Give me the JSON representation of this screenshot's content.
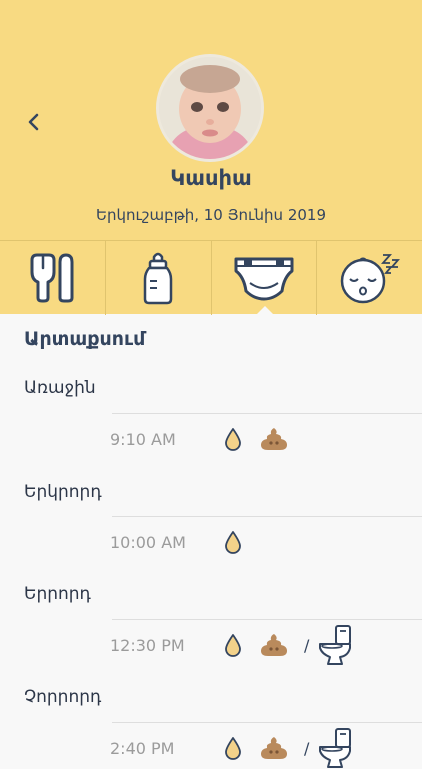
{
  "header": {
    "name": "Կասիա",
    "date": "Երկուշաբթի, 10 Յունիս 2019"
  },
  "colors": {
    "header_bg": "#f8da82",
    "accent_text": "#34455f",
    "pee_drop": "#f3d28a",
    "poop": "#b98a5c"
  },
  "tabs": [
    {
      "icon": "feeding-icon"
    },
    {
      "icon": "bottle-icon"
    },
    {
      "icon": "diaper-icon",
      "selected": true
    },
    {
      "icon": "sleep-icon"
    }
  ],
  "section": {
    "title": "Արտաքսում"
  },
  "entries": [
    {
      "label": "Առաջին",
      "time": "9:10 AM",
      "icons": [
        "drop-icon",
        "poop-icon"
      ]
    },
    {
      "label": "Երկրորդ",
      "time": "10:00 AM",
      "icons": [
        "drop-icon"
      ]
    },
    {
      "label": "Երրորդ",
      "time": "12:30 PM",
      "icons": [
        "drop-icon",
        "poop-icon",
        "toilet-icon"
      ]
    },
    {
      "label": "Չորրորդ",
      "time": "2:40 PM",
      "icons": [
        "drop-icon",
        "poop-icon",
        "toilet-icon"
      ]
    }
  ],
  "separator": "/"
}
